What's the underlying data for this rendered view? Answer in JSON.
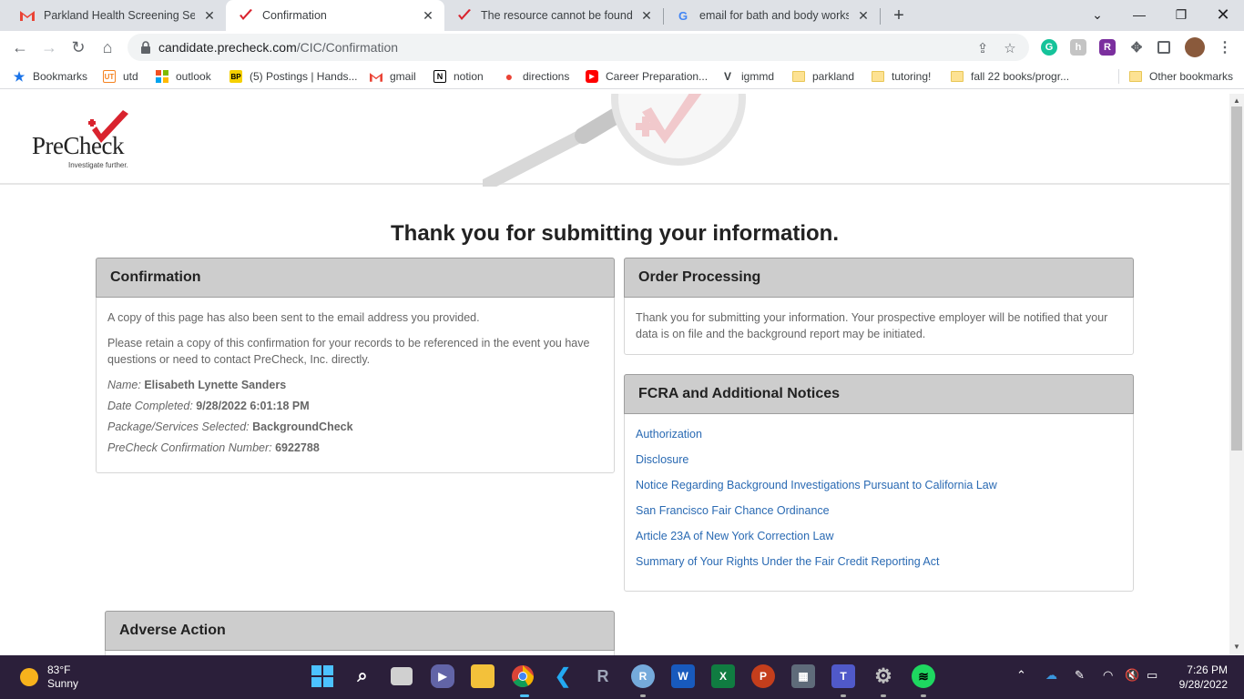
{
  "browser": {
    "tabs": [
      {
        "title": "Parkland Health Screening Servic",
        "icon": "gmail-icon",
        "active": false
      },
      {
        "title": "Confirmation",
        "icon": "precheck-icon",
        "active": true
      },
      {
        "title": "The resource cannot be found.",
        "icon": "precheck-icon",
        "active": false
      },
      {
        "title": "email for bath and body works -",
        "icon": "google-icon",
        "active": false
      }
    ],
    "url_host": "candidate.precheck.com",
    "url_path": "/CIC/Confirmation",
    "bookmarks": [
      {
        "label": "Bookmarks",
        "icon": "star-icon"
      },
      {
        "label": "utd",
        "icon": "utd-icon"
      },
      {
        "label": "outlook",
        "icon": "microsoft-icon"
      },
      {
        "label": "(5) Postings | Hands...",
        "icon": "bp-icon"
      },
      {
        "label": "gmail",
        "icon": "gmail-icon"
      },
      {
        "label": "notion",
        "icon": "notion-icon"
      },
      {
        "label": "directions",
        "icon": "maps-icon"
      },
      {
        "label": "Career Preparation...",
        "icon": "youtube-icon"
      },
      {
        "label": "igmmd",
        "icon": "v-icon"
      },
      {
        "label": "parkland",
        "icon": "folder-icon"
      },
      {
        "label": "tutoring!",
        "icon": "folder-icon"
      },
      {
        "label": "fall 22 books/progr...",
        "icon": "folder-icon"
      },
      {
        "label": "Other bookmarks",
        "icon": "folder-icon"
      }
    ]
  },
  "site": {
    "logo_text": "PreCheck",
    "logo_tagline": "Investigate further."
  },
  "main": {
    "heading": "Thank you for submitting your information.",
    "confirmation": {
      "title": "Confirmation",
      "para1": "A copy of this page has also been sent to the email address you provided.",
      "para2": "Please retain a copy of this confirmation for your records to be referenced in the event you have questions or need to contact PreCheck, Inc. directly.",
      "name_label": "Name:",
      "name_value": "Elisabeth Lynette Sanders",
      "date_label": "Date Completed:",
      "date_value": "9/28/2022 6:01:18 PM",
      "package_label": "Package/Services Selected:",
      "package_value": "BackgroundCheck",
      "number_label": "PreCheck Confirmation Number:",
      "number_value": "6922788"
    },
    "order_processing": {
      "title": "Order Processing",
      "text": "Thank you for submitting your information. Your prospective employer will be notified that your data is on file and the background report may be initiated."
    },
    "fcra": {
      "title": "FCRA and Additional Notices",
      "links": [
        "Authorization",
        "Disclosure",
        "Notice Regarding Background Investigations Pursuant to California Law",
        "San Francisco Fair Chance Ordinance",
        "Article 23A of New York Correction Law",
        "Summary of Your Rights Under the Fair Credit Reporting Act"
      ]
    },
    "adverse_action": {
      "title": "Adverse Action"
    }
  },
  "taskbar": {
    "temperature": "83°F",
    "condition": "Sunny",
    "time": "7:26 PM",
    "date": "9/28/2022"
  },
  "colors": {
    "link": "#2a6ab3",
    "panel_header": "#cdcdcd",
    "brand_red": "#d9232e",
    "taskbar": "#2b1f3a"
  }
}
